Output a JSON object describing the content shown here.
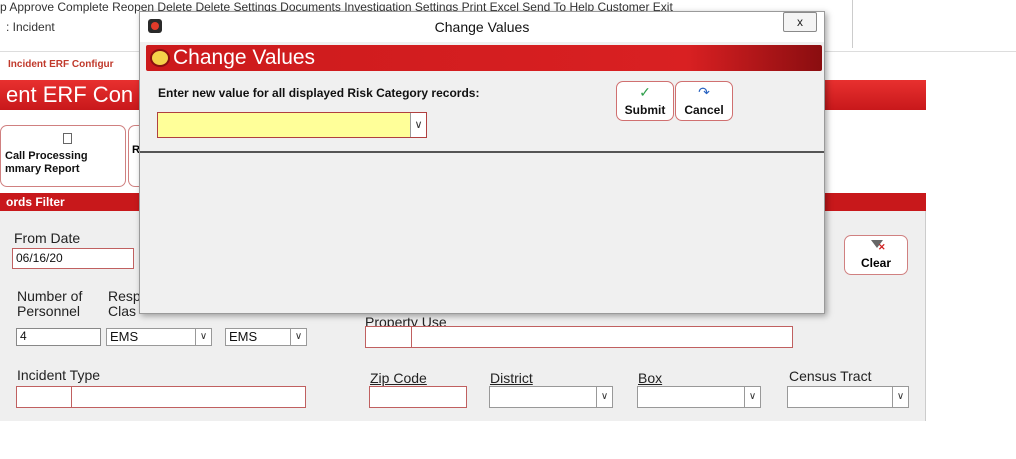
{
  "background": {
    "menu_text": "p Approve Complete Reopen Delete Delete Settings Documents Investigation Settings Print Excel Send To Help Customer Exit",
    "subtitle": ": Incident",
    "breadcrumb": "Incident ERF Configur",
    "page_title": "ent ERF Con",
    "report_card_label": "Call Processing\nmmary Report",
    "report_card2_label": "R",
    "filter_title": "ords Filter",
    "from_date_label": "From Date",
    "from_date_value": "06/16/20",
    "number_label": "Number of\nPersonnel",
    "number_value": "4",
    "resp_label": "Resp\nClas",
    "resp_value": "EMS",
    "cat_value": "EMS",
    "property_label": "Property Use",
    "incident_type_label": "Incident Type",
    "zip_label": "Zip Code",
    "district_label": "District",
    "box_label": "Box",
    "census_label": "Census Tract",
    "clear_label": "Clear"
  },
  "modal": {
    "window_title": "Change Values",
    "close_label": "x",
    "header": "Change Values",
    "prompt": "Enter new value for all displayed Risk Category records:",
    "select_value": "",
    "submit_label": "Submit",
    "cancel_label": "Cancel",
    "submit_icon": "check-icon",
    "cancel_icon": "redo-arrow-icon"
  },
  "colors": {
    "brand_red": "#c8181b",
    "select_yellow": "#ffff99",
    "submit_check": "#2e9e4a",
    "cancel_arrow": "#2a63c0"
  }
}
